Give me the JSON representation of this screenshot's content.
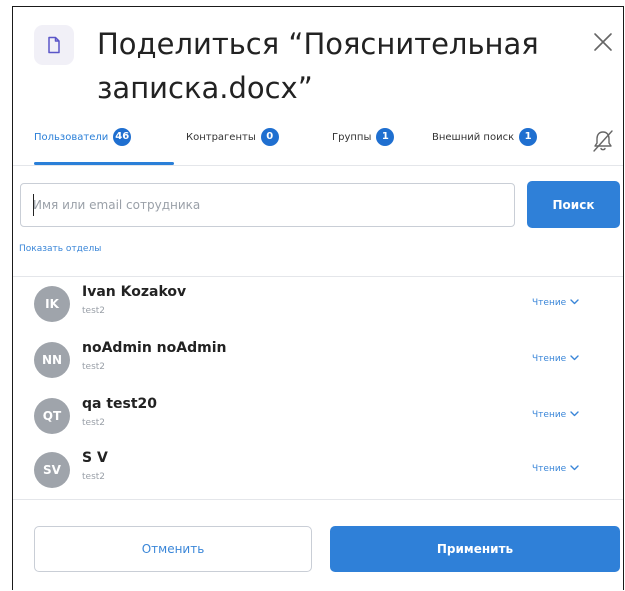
{
  "dialog": {
    "title": "Поделиться “Пояснительная записка.docx”",
    "doc_icon": "document-icon",
    "close_icon": "close-icon"
  },
  "tabs": [
    {
      "label": "Пользователи",
      "count": "46",
      "active": true
    },
    {
      "label": "Контрагенты",
      "count": "0",
      "active": false
    },
    {
      "label": "Группы",
      "count": "1",
      "active": false
    },
    {
      "label": "Внешний поиск",
      "count": "1",
      "active": false
    }
  ],
  "notify_icon": "bell-off-icon",
  "search": {
    "placeholder": "Имя или email сотрудника",
    "button_label": "Поиск"
  },
  "show_departments_label": "Показать отделы",
  "users": [
    {
      "initials": "IK",
      "name": "Ivan Kozakov",
      "sub": "test2",
      "role": "Чтение"
    },
    {
      "initials": "NN",
      "name": "noAdmin noAdmin",
      "sub": "test2",
      "role": "Чтение"
    },
    {
      "initials": "QT",
      "name": "qa test20",
      "sub": "test2",
      "role": "Чтение"
    },
    {
      "initials": "SV",
      "name": "S V",
      "sub": "test2",
      "role": "Чтение"
    }
  ],
  "footer": {
    "cancel_label": "Отменить",
    "apply_label": "Применить"
  },
  "colors": {
    "accent": "#2f80d8",
    "avatar": "#9fa4ab"
  }
}
